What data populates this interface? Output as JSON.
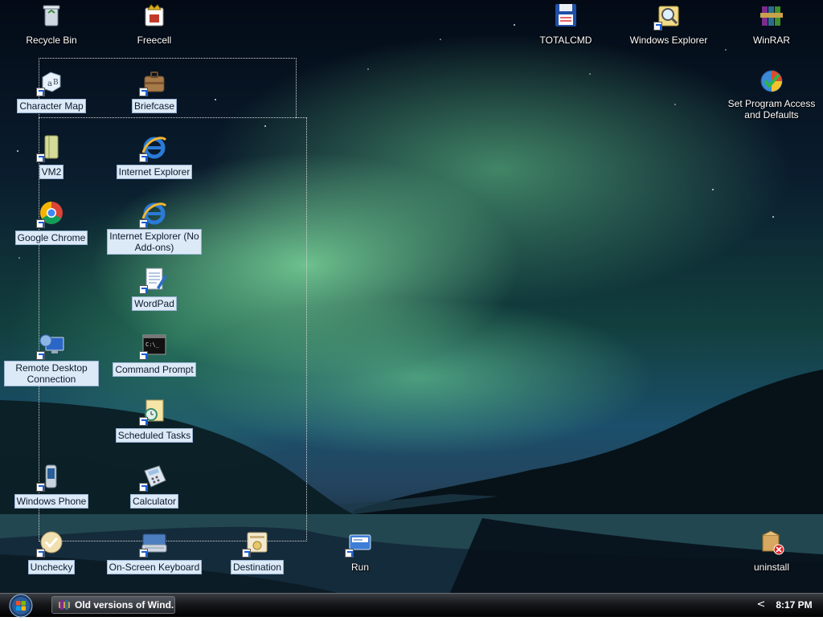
{
  "desktop": {
    "icons": [
      {
        "label": "Recycle Bin",
        "icon": "recycle-bin-icon"
      },
      {
        "label": "Freecell",
        "icon": "freecell-icon"
      },
      {
        "label": "TOTALCMD",
        "icon": "floppy-disk-icon"
      },
      {
        "label": "Windows Explorer",
        "icon": "magnifier-folder-icon"
      },
      {
        "label": "WinRAR",
        "icon": "winrar-books-icon"
      },
      {
        "label": "Character Map",
        "icon": "character-map-icon"
      },
      {
        "label": "Briefcase",
        "icon": "briefcase-icon"
      },
      {
        "label": "Set Program Access and Defaults",
        "icon": "program-defaults-icon"
      },
      {
        "label": "VM2",
        "icon": "folder-icon"
      },
      {
        "label": "Internet Explorer",
        "icon": "internet-explorer-icon"
      },
      {
        "label": "Google Chrome",
        "icon": "chrome-icon"
      },
      {
        "label": "Internet Explorer (No Add-ons)",
        "icon": "internet-explorer-icon"
      },
      {
        "label": "WordPad",
        "icon": "wordpad-icon"
      },
      {
        "label": "Remote Desktop Connection",
        "icon": "remote-desktop-icon"
      },
      {
        "label": "Command Prompt",
        "icon": "command-prompt-icon"
      },
      {
        "label": "Scheduled Tasks",
        "icon": "scheduled-tasks-icon"
      },
      {
        "label": "Windows Phone",
        "icon": "phone-icon"
      },
      {
        "label": "Calculator",
        "icon": "calculator-icon"
      },
      {
        "label": "Unchecky",
        "icon": "unchecky-icon"
      },
      {
        "label": "On-Screen Keyboard",
        "icon": "keyboard-icon"
      },
      {
        "label": "Destination",
        "icon": "destination-icon"
      },
      {
        "label": "Run",
        "icon": "run-icon"
      },
      {
        "label": "uninstall",
        "icon": "uninstall-icon"
      }
    ]
  },
  "taskbar": {
    "start_icon": "windows-orb-icon",
    "task_button": {
      "label": "Old versions of Wind...",
      "icon": "winrar-icon"
    },
    "tray_arrow": "<",
    "clock": "8:17 PM"
  },
  "colors": {
    "selection_bg": "#dce9f6",
    "taskbar": "#15171a"
  }
}
